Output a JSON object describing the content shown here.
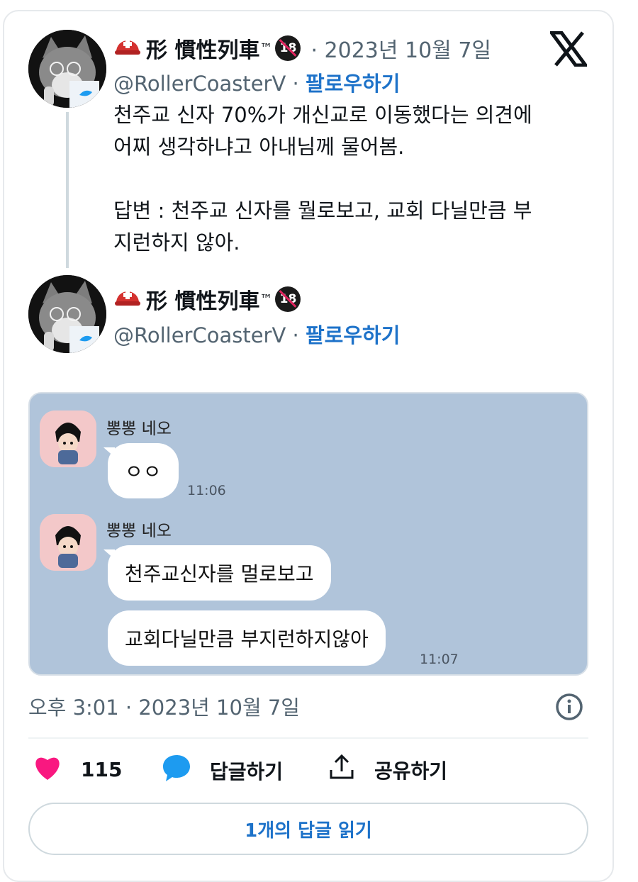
{
  "tweet": {
    "author_name": "形 慣性列車",
    "trademark": "™",
    "age_badge": "18",
    "date": "· 2023년 10월 7일",
    "handle": "@RollerCoasterV",
    "separator": "·",
    "follow_label": "팔로우하기",
    "text": "천주교 신자 70%가 개신교로 이동했다는 의견에\n어찌 생각하냐고 아내님께 물어봄.\n\n답변 : 천주교 신자를 뭘로보고, 교회 다닐만큼 부\n지런하지 않아."
  },
  "reply": {
    "author_name": "形 慣性列車",
    "trademark": "™",
    "age_badge": "18",
    "handle": "@RollerCoasterV",
    "separator": "·",
    "follow_label": "팔로우하기"
  },
  "chat": {
    "messages": [
      {
        "sender": "뽕뽕 네오",
        "bubbles": [
          "ㅇㅇ"
        ],
        "time": "11:06"
      },
      {
        "sender": "뽕뽕 네오",
        "bubbles": [
          "천주교신자를 멀로보고",
          "교회다닐만큼 부지런하지않아"
        ],
        "time": "11:07"
      }
    ]
  },
  "meta": {
    "timestamp": "오후 3:01 · 2023년 10월 7일"
  },
  "actions": {
    "likes_count": "115",
    "reply_label": "답글하기",
    "share_label": "공유하기",
    "read_replies_label": "1개의 답글 읽기"
  },
  "icons": {
    "like": "heart-icon",
    "reply": "speech-bubble-icon",
    "share": "share-upload-icon",
    "info": "info-icon",
    "logo": "x-logo-icon"
  },
  "colors": {
    "accent": "#1d72c9",
    "like": "#f91880",
    "reply": "#1d9bf0",
    "chat_bg": "#b0c4da",
    "muted": "#536471"
  }
}
